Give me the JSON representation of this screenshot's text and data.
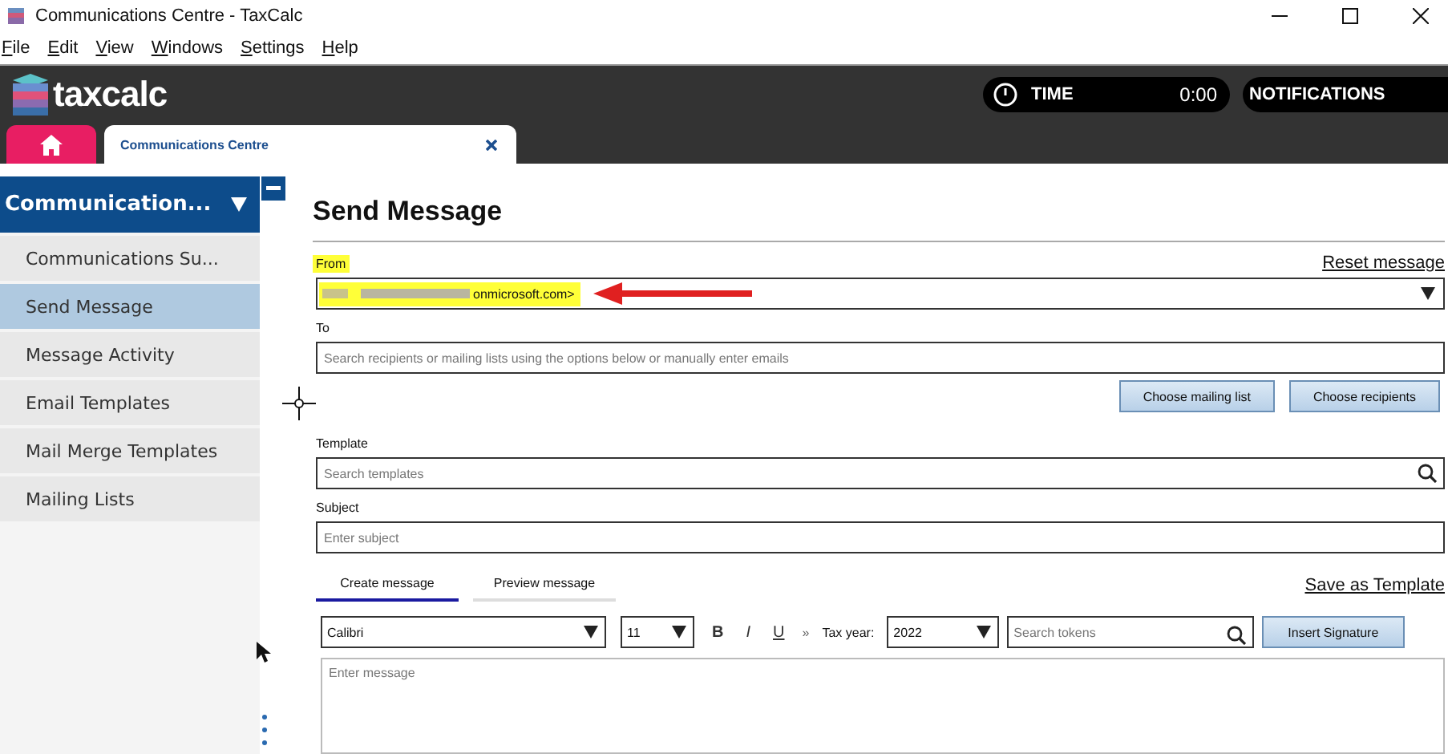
{
  "window": {
    "title": "Communications Centre - TaxCalc"
  },
  "menu": [
    {
      "label": "File"
    },
    {
      "label": "Edit"
    },
    {
      "label": "View"
    },
    {
      "label": "Windows"
    },
    {
      "label": "Settings"
    },
    {
      "label": "Help"
    }
  ],
  "header": {
    "logo": "taxcalc",
    "time_label": "TIME",
    "time_value": "0:00",
    "notifications": "NOTIFICATIONS"
  },
  "doc_tabs": [
    {
      "kind": "home",
      "selected": false
    },
    {
      "kind": "document",
      "label": "Communications Centre",
      "selected": true
    }
  ],
  "sidebar": {
    "header": "Communication...",
    "items": [
      {
        "label": "Communications Su...",
        "selected": false
      },
      {
        "label": "Send Message",
        "selected": true
      },
      {
        "label": "Message Activity",
        "selected": false
      },
      {
        "label": "Email Templates",
        "selected": false
      },
      {
        "label": "Mail Merge Templates",
        "selected": false
      },
      {
        "label": "Mailing Lists",
        "selected": false
      }
    ]
  },
  "form": {
    "title": "Send Message",
    "reset_link": "Reset message",
    "from": {
      "label": "From",
      "value": "onmicrosoft.com>"
    },
    "to": {
      "label": "To",
      "placeholder": "Search recipients or mailing lists using the options below or manually enter emails"
    },
    "buttons": [
      "Choose mailing list",
      "Choose recipients"
    ],
    "template": {
      "label": "Template",
      "placeholder": "Search templates"
    },
    "subject": {
      "label": "Subject",
      "placeholder": "Enter subject"
    },
    "editor_tabs": [
      {
        "label": "Create message",
        "selected": true
      },
      {
        "label": "Preview message",
        "selected": false
      }
    ],
    "save_template": "Save as Template",
    "toolbar": {
      "font": "Calibri",
      "size": "11",
      "format_buttons": [
        "B",
        "I",
        "U"
      ],
      "more": "»",
      "tax_year_label": "Tax year:",
      "tax_year": "2022",
      "token_placeholder": "Search tokens",
      "insert_signature": "Insert Signature"
    },
    "message_placeholder": "Enter message"
  }
}
